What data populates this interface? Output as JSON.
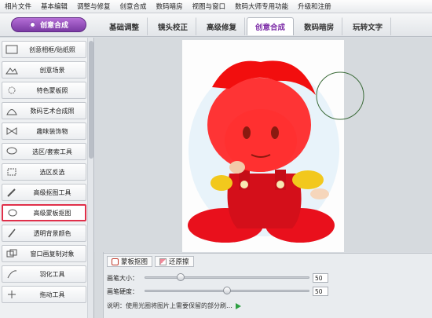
{
  "menu": [
    "相片文件",
    "基本编辑",
    "调整与修复",
    "创意合成",
    "数码暗房",
    "视图与窗口",
    "数码大师专用功能",
    "升级和注册"
  ],
  "mode_button": "创意合成",
  "tabs": [
    {
      "label": "基础调整",
      "active": false
    },
    {
      "label": "镜头校正",
      "active": false
    },
    {
      "label": "高级修复",
      "active": false
    },
    {
      "label": "创意合成",
      "active": true
    },
    {
      "label": "数码暗房",
      "active": false
    },
    {
      "label": "玩转文字",
      "active": false
    }
  ],
  "sidebar": {
    "items": [
      {
        "label": "创意相框/贴纸照",
        "icon": "frame-icon"
      },
      {
        "label": "创意场景",
        "icon": "scene-icon"
      },
      {
        "label": "特色蒙板照",
        "icon": "flower-mask-icon"
      },
      {
        "label": "数码艺术合成照",
        "icon": "art-icon"
      },
      {
        "label": "趣味装饰物",
        "icon": "bow-icon"
      },
      {
        "label": "选区/套索工具",
        "icon": "lasso-icon"
      },
      {
        "label": "选区反选",
        "icon": "invert-selection-icon"
      },
      {
        "label": "高级抠图工具",
        "icon": "cutout-icon"
      },
      {
        "label": "高级蒙板抠图",
        "icon": "mask-cutout-icon",
        "selected": true
      },
      {
        "label": "透明背景颜色",
        "icon": "brush-icon"
      },
      {
        "label": "窗口画复制对象",
        "icon": "copy-object-icon"
      },
      {
        "label": "羽化工具",
        "icon": "feather-icon"
      },
      {
        "label": "拖动工具",
        "icon": "move-icon"
      }
    ]
  },
  "panel": {
    "tabs": [
      {
        "label": "蒙板抠图",
        "icon": "mask-icon"
      },
      {
        "label": "还原擦",
        "icon": "eraser-icon"
      }
    ],
    "brush_size_label": "画笔大小：",
    "brush_size_value": "50",
    "brush_size_fraction": 0.22,
    "brush_hardness_label": "画笔硬度：",
    "brush_hardness_value": "50",
    "brush_hardness_fraction": 0.5,
    "hint": "说明：使用光圈将图片上需要保留的部分刷…"
  },
  "colors": {
    "accent": "#8f3fc0",
    "mask_overlay": "#ff2020",
    "selected_border": "#e0304a"
  }
}
